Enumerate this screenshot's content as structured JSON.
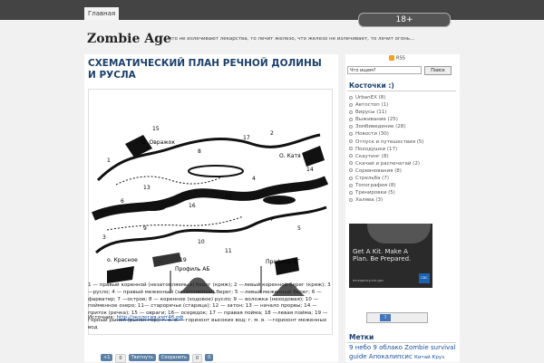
{
  "nav": {
    "home_label": "Главная",
    "age_badge": "18+"
  },
  "site": {
    "title": "Zombie Age",
    "tagline": "что не излечивают лекарства, то лечит железо, что железо не излечивает, то лечит огонь..."
  },
  "post": {
    "title": "СХЕМАТИЧЕСКИЙ ПЛАН РЕЧНОЙ ДОЛИНЫ И РУСЛА",
    "figure_labels": {
      "ravine": "О. Овражок",
      "katya": "О. Катя",
      "krasnoe": "о. Красное",
      "profile_ab": "Профиль АБ",
      "profile_vg": "Профиль ВГ",
      "numbers": [
        "15",
        "1",
        "8",
        "17",
        "14",
        "12",
        "16",
        "7",
        "9",
        "6",
        "2",
        "3",
        "5",
        "10",
        "11",
        "13",
        "4",
        "19"
      ]
    },
    "caption": "1 — правый коренной (незатопляемый) берег (кряж); 2 —левый коренной берег (кряж); 3 —русло; 4 — правый меженный (затопляемый) берег; 5 —левый меженный берег; 6 —фарватер; 7 —остров; 8 — коренное (ходовое) русло; 9 — воложка (неходовая); 10 — пойменное озеро; 11— староречье (старица); 12 — затон; 13 — начало прорвы; 14 — приток (речка); 15 — овраги; 16— осередок; 17 — правая пойма; 18 —левая пойма; 19 — горный рынок (рынок гор); г. в. в. —горизонт высоких вод; г. м. в. —горизонт меженных вод",
    "source_label": "Источник:",
    "source_link": "http://экология.кмт46.рф"
  },
  "share": {
    "like_count": "+1",
    "count1": "0",
    "tweet_label": "Твитнуть",
    "save_label": "Сохранить",
    "count2": "0",
    "vk_label": "0"
  },
  "sidebar": {
    "rss_label": "RSS",
    "search_placeholder": "Что ищем?",
    "search_button": "Поиск",
    "categories_title": "Косточки :)",
    "categories": [
      "UrbanEX (8)",
      "Автостоп (1)",
      "Вирусы (11)",
      "Выживание (25)",
      "Зомбиведение (28)",
      "Новости (30)",
      "Отпуск и путешествия (5)",
      "Походушки (17)",
      "Скаутинг (8)",
      "Скачай и распечатай (2)",
      "Соревнования (8)",
      "Стрельба (7)",
      "Топография (8)",
      "Тренировки (5)",
      "Халява (3)"
    ],
    "poster_text": "Get A Kit. Make A Plan. Be Prepared.",
    "poster_url": "emergency.cdc.gov",
    "poster_logo": "CDC",
    "counter_value": "7",
    "tags_title": "Метки",
    "tags_line1": "9 небо 9 облако Zombie survival",
    "tags_line2_a": "guide Апокалипсис",
    "tags_line2_b": "Китай Круз"
  }
}
